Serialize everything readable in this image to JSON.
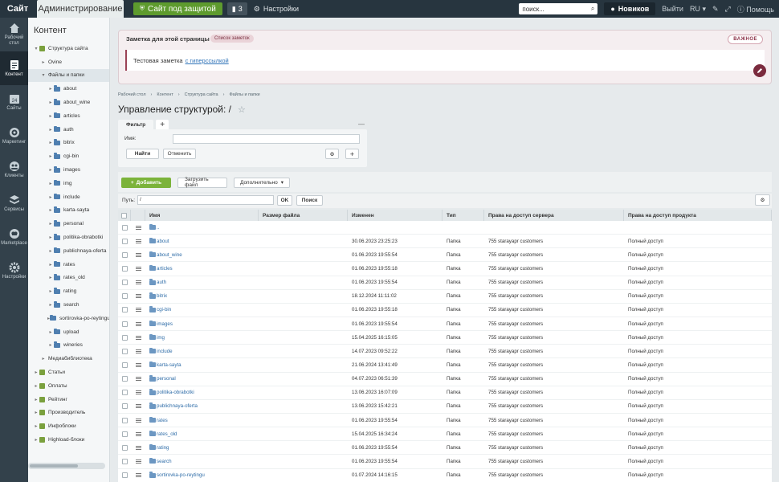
{
  "topbar": {
    "site": "Сайт",
    "admin": "Администрирование",
    "protect": "Сайт под защитой",
    "badge_count": "3",
    "settings": "Настройки",
    "search_placeholder": "поиск...",
    "user": "Новиков",
    "logout": "Выйти",
    "lang": "RU",
    "help": "Помощь"
  },
  "rail": {
    "items": [
      {
        "label": "Рабочий стол",
        "icon": "home-icon"
      },
      {
        "label": "Контент",
        "icon": "document-icon"
      },
      {
        "label": "Сайты",
        "icon": "calendar-icon",
        "num": "24"
      },
      {
        "label": "Маркетинг",
        "icon": "target-icon"
      },
      {
        "label": "Клиенты",
        "icon": "clients-icon"
      },
      {
        "label": "Сервисы",
        "icon": "layers-icon"
      },
      {
        "label": "Marketplace",
        "icon": "cloud-icon"
      },
      {
        "label": "Настройки",
        "icon": "gear-icon"
      }
    ]
  },
  "sidebar": {
    "title": "Контент",
    "tree": [
      {
        "label": "Структура сайта",
        "level": 0,
        "toggle": "▾",
        "icon": "green"
      },
      {
        "label": "Ovine",
        "level": 1,
        "toggle": "▸",
        "icon": "none"
      },
      {
        "label": "Файлы и папки",
        "level": 1,
        "toggle": "▾",
        "icon": "none",
        "active": true
      },
      {
        "label": "about",
        "level": 2,
        "toggle": "▸",
        "icon": "folder"
      },
      {
        "label": "about_wine",
        "level": 2,
        "toggle": "▸",
        "icon": "folder"
      },
      {
        "label": "articles",
        "level": 2,
        "toggle": "▸",
        "icon": "folder"
      },
      {
        "label": "auth",
        "level": 2,
        "toggle": "▸",
        "icon": "folder"
      },
      {
        "label": "bitrix",
        "level": 2,
        "toggle": "▸",
        "icon": "folder"
      },
      {
        "label": "cgi-bin",
        "level": 2,
        "toggle": "▸",
        "icon": "folder"
      },
      {
        "label": "images",
        "level": 2,
        "toggle": "▸",
        "icon": "folder"
      },
      {
        "label": "img",
        "level": 2,
        "toggle": "▸",
        "icon": "folder"
      },
      {
        "label": "include",
        "level": 2,
        "toggle": "▸",
        "icon": "folder"
      },
      {
        "label": "karta-sayta",
        "level": 2,
        "toggle": "▸",
        "icon": "folder"
      },
      {
        "label": "personal",
        "level": 2,
        "toggle": "▸",
        "icon": "folder"
      },
      {
        "label": "politika-obrabotki",
        "level": 2,
        "toggle": "▸",
        "icon": "folder"
      },
      {
        "label": "publichnaya-oferta",
        "level": 2,
        "toggle": "▸",
        "icon": "folder"
      },
      {
        "label": "rates",
        "level": 2,
        "toggle": "▸",
        "icon": "folder"
      },
      {
        "label": "rates_old",
        "level": 2,
        "toggle": "▸",
        "icon": "folder"
      },
      {
        "label": "rating",
        "level": 2,
        "toggle": "▸",
        "icon": "folder"
      },
      {
        "label": "search",
        "level": 2,
        "toggle": "▸",
        "icon": "folder"
      },
      {
        "label": "sortirovka-po-reytingu",
        "level": 2,
        "toggle": "▸",
        "icon": "folder"
      },
      {
        "label": "upload",
        "level": 2,
        "toggle": "▸",
        "icon": "folder"
      },
      {
        "label": "wineries",
        "level": 2,
        "toggle": "▸",
        "icon": "folder"
      },
      {
        "label": "Медиабиблиотека",
        "level": 1,
        "toggle": "▸",
        "icon": "none"
      },
      {
        "label": "Статьи",
        "level": 0,
        "toggle": "▸",
        "icon": "green"
      },
      {
        "label": "Оплаты",
        "level": 0,
        "toggle": "▸",
        "icon": "green"
      },
      {
        "label": "Рейтинг",
        "level": 0,
        "toggle": "▸",
        "icon": "green"
      },
      {
        "label": "Производитель",
        "level": 0,
        "toggle": "▸",
        "icon": "green"
      },
      {
        "label": "Инфоблоки",
        "level": 0,
        "toggle": "▸",
        "icon": "green"
      },
      {
        "label": "Highload-блоки",
        "level": 0,
        "toggle": "▸",
        "icon": "green"
      }
    ]
  },
  "note": {
    "title": "Заметка для этой страницы",
    "tag": "Список заметок",
    "text": "Тестовая заметка",
    "link": "с гиперссылкой",
    "important": "ВАЖНОЕ"
  },
  "breadcrumbs": [
    "Рабочий стол",
    "Контент",
    "Структура сайта",
    "Файлы и папки"
  ],
  "page_title": "Управление структурой: /",
  "filter": {
    "tab": "Фильтр",
    "plus": "+",
    "minimize": "—",
    "name_label": "Имя:",
    "find": "Найти",
    "cancel": "Отменить"
  },
  "toolbar": {
    "add": "Добавить",
    "upload": "Загрузить файл",
    "more": "Дополнительно"
  },
  "path": {
    "label": "Путь:",
    "value": "/",
    "ok": "OK",
    "search": "Поиск"
  },
  "table": {
    "headers": [
      "Имя",
      "Размер файла",
      "Изменен",
      "Тип",
      "Права на доступ сервера",
      "Права на доступ продукта"
    ],
    "up_row": "..",
    "rows": [
      {
        "name": "about",
        "modified": "30.06.2023 23:25:23",
        "type": "Папка",
        "rights": "755 starayapr customers",
        "product": "Полный доступ"
      },
      {
        "name": "about_wine",
        "modified": "01.06.2023 19:55:54",
        "type": "Папка",
        "rights": "755 starayapr customers",
        "product": "Полный доступ"
      },
      {
        "name": "articles",
        "modified": "01.06.2023 19:55:18",
        "type": "Папка",
        "rights": "755 starayapr customers",
        "product": "Полный доступ"
      },
      {
        "name": "auth",
        "modified": "01.06.2023 19:55:54",
        "type": "Папка",
        "rights": "755 starayapr customers",
        "product": "Полный доступ"
      },
      {
        "name": "bitrix",
        "modified": "18.12.2024 11:11:02",
        "type": "Папка",
        "rights": "755 starayapr customers",
        "product": "Полный доступ"
      },
      {
        "name": "cgi-bin",
        "modified": "01.06.2023 19:55:18",
        "type": "Папка",
        "rights": "755 starayapr customers",
        "product": "Полный доступ"
      },
      {
        "name": "images",
        "modified": "01.06.2023 19:55:54",
        "type": "Папка",
        "rights": "755 starayapr customers",
        "product": "Полный доступ"
      },
      {
        "name": "img",
        "modified": "15.04.2025 16:15:05",
        "type": "Папка",
        "rights": "755 starayapr customers",
        "product": "Полный доступ"
      },
      {
        "name": "include",
        "modified": "14.07.2023 09:52:22",
        "type": "Папка",
        "rights": "755 starayapr customers",
        "product": "Полный доступ"
      },
      {
        "name": "karta-sayta",
        "modified": "21.06.2024 13:41:49",
        "type": "Папка",
        "rights": "755 starayapr customers",
        "product": "Полный доступ"
      },
      {
        "name": "personal",
        "modified": "04.07.2023 06:51:39",
        "type": "Папка",
        "rights": "755 starayapr customers",
        "product": "Полный доступ"
      },
      {
        "name": "politika-obrabotki",
        "modified": "13.06.2023 16:07:09",
        "type": "Папка",
        "rights": "755 starayapr customers",
        "product": "Полный доступ"
      },
      {
        "name": "publichnaya-oferta",
        "modified": "13.06.2023 15:42:21",
        "type": "Папка",
        "rights": "755 starayapr customers",
        "product": "Полный доступ"
      },
      {
        "name": "rates",
        "modified": "01.06.2023 19:55:54",
        "type": "Папка",
        "rights": "755 starayapr customers",
        "product": "Полный доступ"
      },
      {
        "name": "rates_old",
        "modified": "15.04.2025 16:34:24",
        "type": "Папка",
        "rights": "755 starayapr customers",
        "product": "Полный доступ"
      },
      {
        "name": "rating",
        "modified": "01.06.2023 19:55:54",
        "type": "Папка",
        "rights": "755 starayapr customers",
        "product": "Полный доступ"
      },
      {
        "name": "search",
        "modified": "01.06.2023 19:55:54",
        "type": "Папка",
        "rights": "755 starayapr customers",
        "product": "Полный доступ"
      },
      {
        "name": "sortirovka-po-reytingu",
        "modified": "01.07.2024 14:16:15",
        "type": "Папка",
        "rights": "755 starayapr customers",
        "product": "Полный доступ"
      }
    ]
  }
}
